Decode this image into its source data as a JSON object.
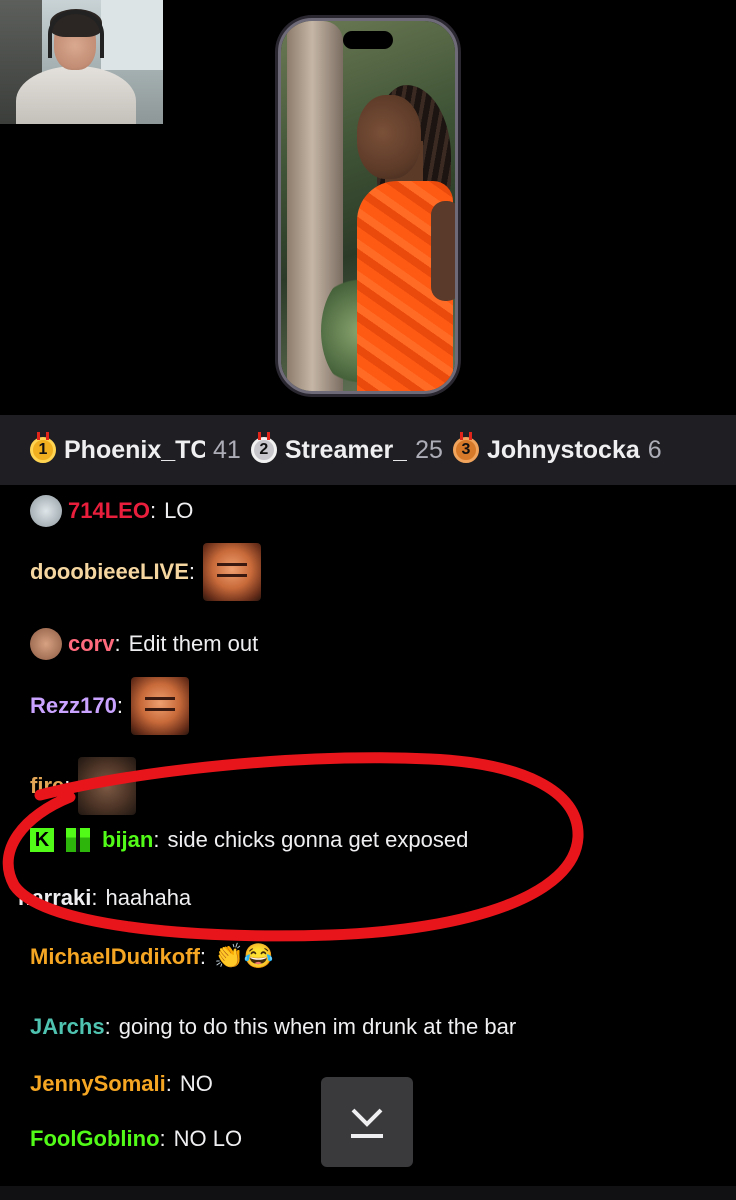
{
  "leaderboard": {
    "entries": [
      {
        "rank": "1",
        "name": "Phoenix_TC",
        "count": "41",
        "tier": "gold"
      },
      {
        "rank": "2",
        "name": "Streamer_",
        "count": "25",
        "tier": "silver"
      },
      {
        "rank": "3",
        "name": "Johnystocka",
        "count": "6",
        "tier": "bronze"
      }
    ]
  },
  "chat": {
    "messages": [
      {
        "user": "714LEO",
        "color": "#e91e3c",
        "text": "LO",
        "badge": "silver-coin"
      },
      {
        "user": "dooobieeeLIVE",
        "color": "#f5d6a0",
        "text": "",
        "emote": "leo-emote"
      },
      {
        "user": "corv",
        "color": "#ff6b7d",
        "text": "Edit them out",
        "badge": "bronze-coin"
      },
      {
        "user": "Rezz170",
        "color": "#c9a3ff",
        "text": "",
        "emote": "leo-emote"
      },
      {
        "user": "fire",
        "color": "#e3a657",
        "text": "",
        "emote": "face-emote"
      },
      {
        "user": "bijan",
        "color": "#53fc18",
        "text": "side chicks gonna get exposed",
        "badges": [
          "kick-badge",
          "gift-badge"
        ]
      },
      {
        "user": "narraki",
        "color": "#efeff1",
        "text": "haahaha"
      },
      {
        "user": "MichaelDudikoff",
        "color": "#f5a623",
        "text": "",
        "emote": "clap-laugh-emote"
      },
      {
        "user": "JArchs",
        "color": "#4fc3b0",
        "text": "going to do this when im drunk at the bar"
      },
      {
        "user": "JennySomali",
        "color": "#f5a623",
        "text": "NO"
      },
      {
        "user": "FoolGoblino",
        "color": "#53fc18",
        "text": "NO LO"
      }
    ],
    "colon": ":"
  },
  "colors": {
    "annotation": "#e8151b",
    "leaderboard_bg": "#1f1f23",
    "chat_bg": "#000000"
  },
  "icons": {
    "scroll_down": "chevron-down-to-bottom-icon"
  }
}
